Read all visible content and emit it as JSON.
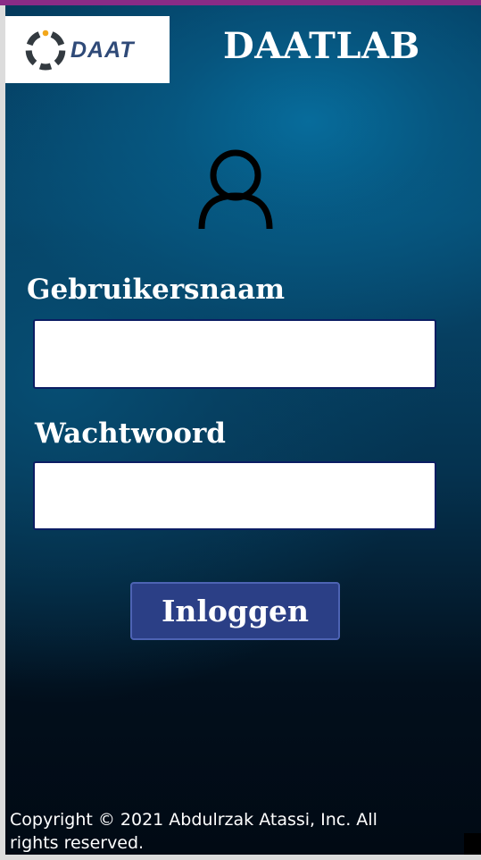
{
  "brand": {
    "logo_text": "DAAT",
    "app_title": "DAATLAB"
  },
  "icons": {
    "logo": "daat-logo-ring",
    "user": "user-icon"
  },
  "form": {
    "username_label": "Gebruikersnaam",
    "username_value": "",
    "password_label": "Wachtwoord",
    "password_value": "",
    "login_label": "Inloggen"
  },
  "footer": {
    "copyright": "Copyright © 2021 Abdulrzak Atassi, Inc. All rights reserved."
  },
  "colors": {
    "accent_bar": "#8a2b86",
    "button": "#2b3f86",
    "field_border": "#0b1d63",
    "logo_text": "#2f4a78"
  }
}
